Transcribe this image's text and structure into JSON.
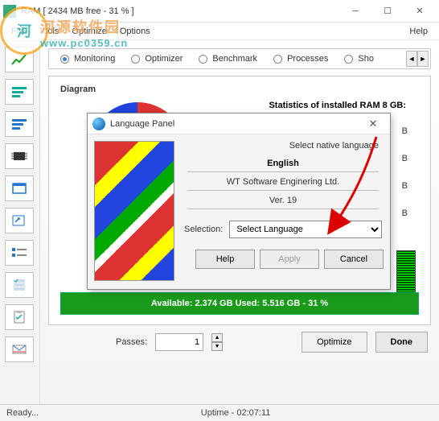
{
  "window": {
    "title": "RAM [ 2434 MB free - 31 % ]"
  },
  "menu": {
    "file": "File",
    "tools": "Tools",
    "optimize": "Optimize",
    "options": "Options",
    "help": "Help"
  },
  "watermark": {
    "cn": "河源软件园",
    "url": "www.pc0359.cn"
  },
  "tabs": {
    "monitoring": "Monitoring",
    "optimizer": "Optimizer",
    "benchmark": "Benchmark",
    "processes": "Processes",
    "shortcuts": "Sho"
  },
  "panel": {
    "diagram": "Diagram",
    "stats_title": "Statistics of installed RAM 8 GB:",
    "unit": "B",
    "available": "Available: 2.374 GB  Used: 5.516 GB - 31 %"
  },
  "footer": {
    "passes_label": "Passes:",
    "passes_value": "1",
    "optimize": "Optimize",
    "done": "Done"
  },
  "status": {
    "ready": "Ready...",
    "uptime": "Uptime - 02:07:11"
  },
  "dialog": {
    "title": "Language Panel",
    "native_label": "Select native language",
    "language": "English",
    "company": "WT Software Enginering Ltd.",
    "version": "Ver. 19",
    "selection_label": "Selection:",
    "select_placeholder": "Select Language",
    "help": "Help",
    "apply": "Apply",
    "cancel": "Cancel"
  },
  "icons": {
    "chart": "chart-icon",
    "bars_green": "bars-green-icon",
    "bars_blue": "bars-blue-icon",
    "chip": "chip-icon",
    "window": "window-icon",
    "shortcut": "shortcut-icon",
    "checklist": "checklist-icon",
    "checklist2": "checklist-stack-icon",
    "clipboard": "clipboard-icon",
    "envelope": "envelope-icon"
  }
}
